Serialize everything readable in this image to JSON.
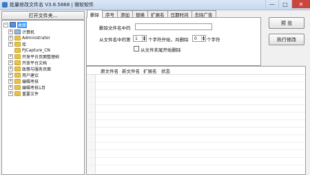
{
  "window": {
    "title": "批量修改文件名 V3.6.5868 | 微软软件",
    "controls": [
      "—",
      "□",
      "✕"
    ]
  },
  "left": {
    "open_folder_label": "打开文件夹...",
    "tree": [
      {
        "label": "桌面",
        "icon": "desktop-icon",
        "expander": "−",
        "selected": true
      },
      {
        "label": "计算机",
        "icon": "computer-icon",
        "expander": "+"
      },
      {
        "label": "Administrator",
        "icon": "folder-icon",
        "expander": "+"
      },
      {
        "label": "库",
        "icon": "folder-icon",
        "expander": "+"
      },
      {
        "label": "PJCapture_CN",
        "icon": "folder-icon",
        "expander": ""
      },
      {
        "label": "开发平台页面整理树",
        "icon": "folder-icon",
        "expander": "+"
      },
      {
        "label": "开放平台文档",
        "icon": "folder-icon",
        "expander": "+"
      },
      {
        "label": "政策与服务页面",
        "icon": "folder-icon",
        "expander": "+"
      },
      {
        "label": "用户建议",
        "icon": "folder-icon",
        "expander": "+"
      },
      {
        "label": "编辑考核",
        "icon": "folder-icon",
        "expander": "+"
      },
      {
        "label": "编辑考核1月",
        "icon": "folder-icon",
        "expander": "+"
      },
      {
        "label": "重要文件",
        "icon": "folder-icon",
        "expander": "+"
      }
    ]
  },
  "tabs": [
    "删除",
    "序号",
    "添加",
    "替换",
    "扩展名",
    "日期时间",
    "去除广告"
  ],
  "active_tab": "删除",
  "delete_panel": {
    "delete_label": "删除文件名中的",
    "delete_value": "",
    "from_label": "从文件名中的第",
    "from_value": "1",
    "chars_start_label": "个字符开始，共删除",
    "count_value": "0",
    "chars_label": "个字符",
    "from_end_label": "从文件末尾开始删除"
  },
  "buttons": {
    "preview": "预  览",
    "execute": "执行修改"
  },
  "grid": {
    "columns": [
      "原文件名",
      "新文件名",
      "扩展名",
      "状态"
    ]
  }
}
